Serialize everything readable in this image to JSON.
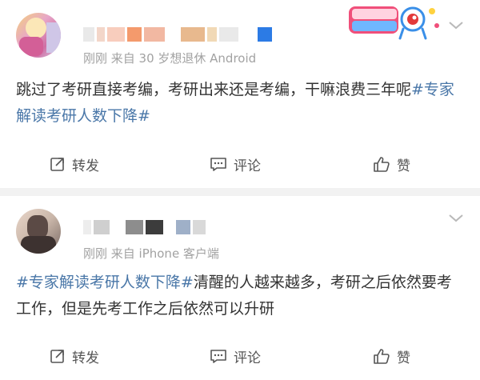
{
  "colors": {
    "hashtag": "#4a77a8",
    "meta": "#a2a2a2",
    "separator": "#f2f2f2"
  },
  "posts": [
    {
      "meta": "刚刚  来自 30 岁想退休 Android",
      "badge_icon": "national-day-promo-sticker",
      "text_parts": [
        "跳过了考研直接考编，考研出来还是考编，干嘛浪费三年呢",
        "#专家解读考研人数下降#"
      ],
      "actions": {
        "repost": "转发",
        "comment": "评论",
        "like": "赞"
      }
    },
    {
      "meta": "刚刚  来自 iPhone 客户端",
      "text_parts": [
        "#专家解读考研人数下降#",
        "清醒的人越来越多，考研之后依然要考工作，但是先考工作之后依然可以升研"
      ],
      "actions": {
        "repost": "转发",
        "comment": "评论",
        "like": "赞"
      }
    }
  ]
}
